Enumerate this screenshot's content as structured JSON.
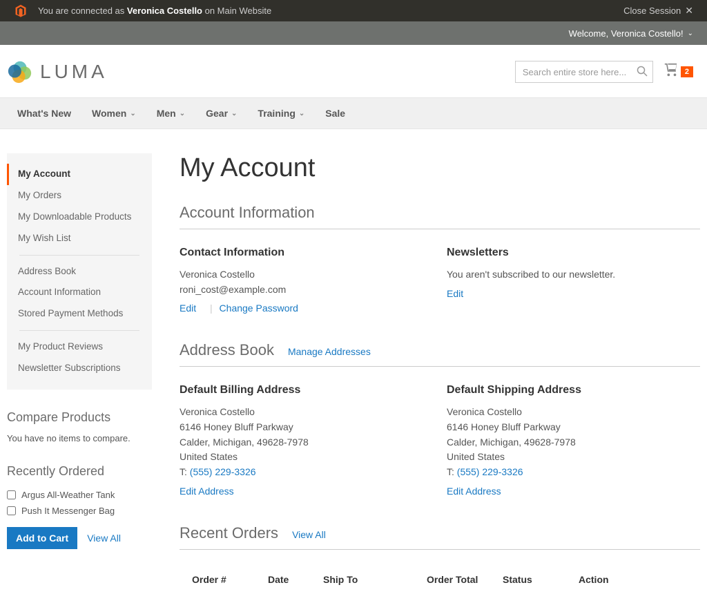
{
  "admin": {
    "connected_prefix": "You are connected as ",
    "connected_name": "Veronica Costello",
    "connected_suffix": " on Main Website",
    "close": "Close Session"
  },
  "welcome": {
    "text": "Welcome, Veronica Costello!"
  },
  "logo": {
    "text": "LUMA"
  },
  "search": {
    "placeholder": "Search entire store here..."
  },
  "cart": {
    "count": "2"
  },
  "nav": {
    "items": [
      {
        "label": "What's New",
        "has_chevron": false
      },
      {
        "label": "Women",
        "has_chevron": true
      },
      {
        "label": "Men",
        "has_chevron": true
      },
      {
        "label": "Gear",
        "has_chevron": true
      },
      {
        "label": "Training",
        "has_chevron": true
      },
      {
        "label": "Sale",
        "has_chevron": false
      }
    ]
  },
  "account_nav": {
    "groups": [
      [
        "My Account",
        "My Orders",
        "My Downloadable Products",
        "My Wish List"
      ],
      [
        "Address Book",
        "Account Information",
        "Stored Payment Methods"
      ],
      [
        "My Product Reviews",
        "Newsletter Subscriptions"
      ]
    ],
    "active": "My Account"
  },
  "compare": {
    "title": "Compare Products",
    "empty": "You have no items to compare."
  },
  "recent": {
    "title": "Recently Ordered",
    "items": [
      "Argus All-Weather Tank",
      "Push It Messenger Bag"
    ],
    "add_btn": "Add to Cart",
    "view_all": "View All"
  },
  "page": {
    "title": "My Account"
  },
  "account_info": {
    "heading": "Account Information",
    "contact": {
      "title": "Contact Information",
      "name": "Veronica Costello",
      "email": "roni_cost@example.com",
      "edit": "Edit",
      "change_pw": "Change Password"
    },
    "newsletters": {
      "title": "Newsletters",
      "msg": "You aren't subscribed to our newsletter.",
      "edit": "Edit"
    }
  },
  "address_book": {
    "heading": "Address Book",
    "manage": "Manage Addresses",
    "billing": {
      "title": "Default Billing Address",
      "name": "Veronica Costello",
      "street": "6146 Honey Bluff Parkway",
      "city": "Calder, Michigan, 49628-7978",
      "country": "United States",
      "phone_label": "T: ",
      "phone": "(555) 229-3326",
      "edit": "Edit Address"
    },
    "shipping": {
      "title": "Default Shipping Address",
      "name": "Veronica Costello",
      "street": "6146 Honey Bluff Parkway",
      "city": "Calder, Michigan, 49628-7978",
      "country": "United States",
      "phone_label": "T: ",
      "phone": "(555) 229-3326",
      "edit": "Edit Address"
    }
  },
  "recent_orders": {
    "heading": "Recent Orders",
    "view_all": "View All",
    "columns": [
      "Order #",
      "Date",
      "Ship To",
      "Order Total",
      "Status",
      "Action"
    ]
  }
}
